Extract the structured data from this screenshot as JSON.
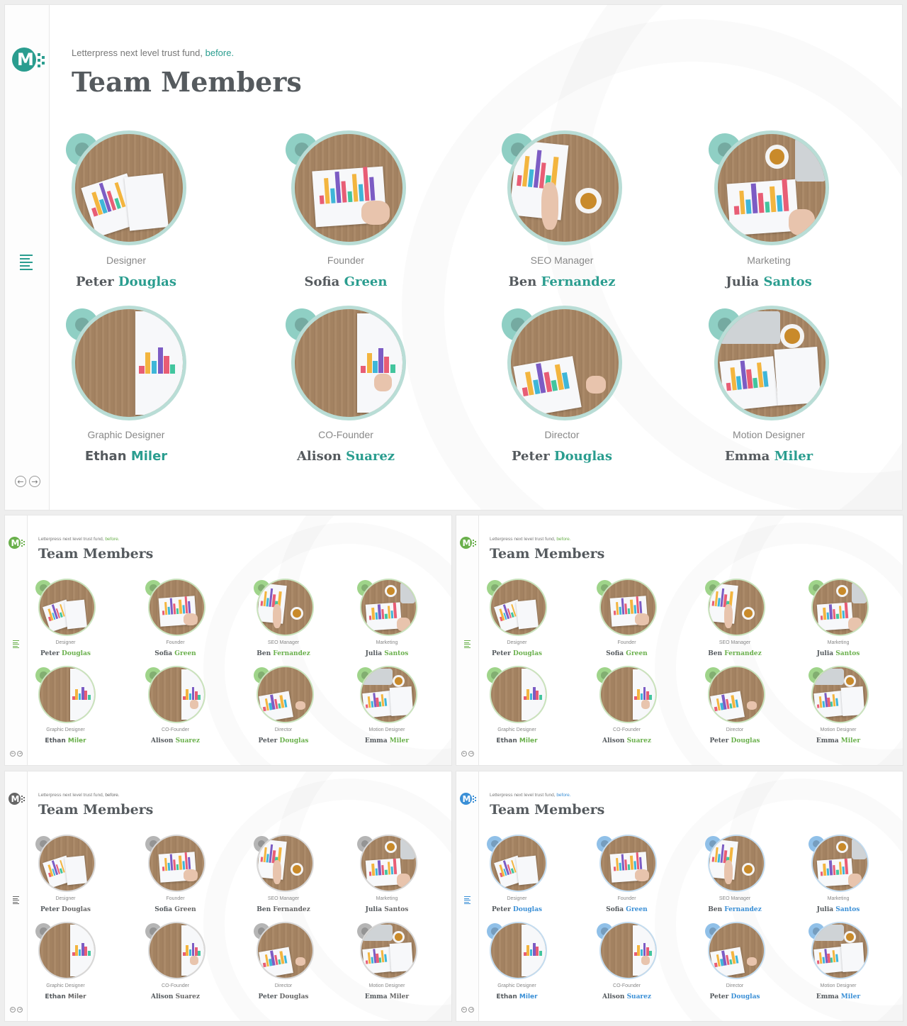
{
  "page": {
    "subtitle_text": "Letterpress next level trust fund, ",
    "subtitle_link": "before.",
    "title": "Team Members",
    "logo_letter": "M"
  },
  "members": [
    {
      "role": "Designer",
      "first": "Peter",
      "last": "Douglas",
      "photo": "a"
    },
    {
      "role": "Founder",
      "first": "Sofia",
      "last": "Green",
      "photo": "b"
    },
    {
      "role": "SEO Manager",
      "first": "Ben",
      "last": "Fernandez",
      "photo": "c"
    },
    {
      "role": "Marketing",
      "first": "Julia",
      "last": "Santos",
      "photo": "d"
    },
    {
      "role": "Graphic Designer",
      "first": "Ethan",
      "last": "Miler",
      "photo": "e"
    },
    {
      "role": "CO-Founder",
      "first": "Alison",
      "last": "Suarez",
      "photo": "f"
    },
    {
      "role": "Director",
      "first": "Peter",
      "last": "Douglas",
      "photo": "g"
    },
    {
      "role": "Motion Designer",
      "first": "Emma",
      "last": "Miler",
      "photo": "h"
    }
  ],
  "variants": [
    {
      "name": "teal",
      "accent": "#2a9d8f",
      "ring": "#b9ddd6",
      "deco": "#8fcfc4"
    },
    {
      "name": "green",
      "accent": "#6ab04c",
      "ring": "#c9e3bd",
      "deco": "#9fd48a"
    },
    {
      "name": "green-alt",
      "accent": "#6ab04c",
      "ring": "#c9e3bd",
      "deco": "#9fd48a"
    },
    {
      "name": "gray",
      "accent": "#666666",
      "ring": "#d8d8d8",
      "deco": "#b5b5b5"
    },
    {
      "name": "blue",
      "accent": "#3a8fd6",
      "ring": "#c3dcf0",
      "deco": "#90c0e8"
    }
  ],
  "icons": [
    "logo-icon",
    "menu-lines-icon",
    "arrow-left-icon",
    "arrow-right-icon"
  ]
}
